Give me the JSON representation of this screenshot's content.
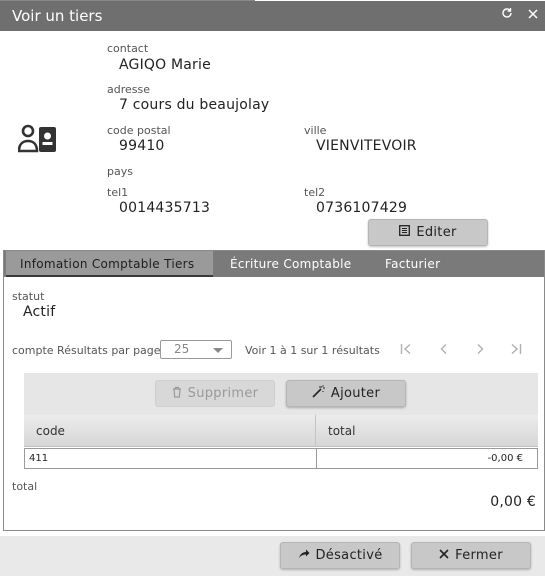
{
  "window": {
    "title": "Voir un tiers",
    "icons": [
      "refresh-icon",
      "close-icon"
    ]
  },
  "contact": {
    "icon": "contact-card-icon",
    "contact_label": "contact",
    "contact_value": "AGIQO Marie",
    "adresse_label": "adresse",
    "adresse_value": "7 cours du beaujolay",
    "code_postal_label": "code postal",
    "code_postal_value": "99410",
    "ville_label": "ville",
    "ville_value": "VIENVITEVOIR",
    "pays_label": "pays",
    "pays_value": "",
    "tel1_label": "tel1",
    "tel1_value": "0014435713",
    "tel2_label": "tel2",
    "tel2_value": "0736107429"
  },
  "edit_button": {
    "label": "Editer",
    "icon": "edit-icon"
  },
  "tabs": [
    {
      "label": "Infomation Comptable Tiers",
      "active": true
    },
    {
      "label": "Écriture Comptable",
      "active": false
    },
    {
      "label": "Facturier",
      "active": false
    }
  ],
  "statut": {
    "label": "statut",
    "value": "Actif"
  },
  "pager": {
    "per_page_label": "compte Résultats par page",
    "per_page_value": "25",
    "summary": "Voir 1 à 1 sur 1 résultats",
    "icons": [
      "first-page-icon",
      "prev-page-icon",
      "next-page-icon",
      "last-page-icon"
    ]
  },
  "grid_toolbar": {
    "delete_label": "Supprimer",
    "delete_icon": "trash-icon",
    "add_label": "Ajouter",
    "add_icon": "magic-wand-icon"
  },
  "grid": {
    "columns": [
      "code",
      "total"
    ],
    "rows": [
      {
        "code": "411",
        "total": "-0,00 €"
      }
    ]
  },
  "total": {
    "label": "total",
    "value": "0,00 €"
  },
  "footer": {
    "deactivate_label": "Désactivé",
    "deactivate_icon": "share-arrow-icon",
    "close_label": "Fermer",
    "close_icon": "close-icon"
  },
  "colors": {
    "titlebar": "#6f6f6f",
    "tabbar": "#7a7a7a",
    "button": "#c8c8c8"
  }
}
